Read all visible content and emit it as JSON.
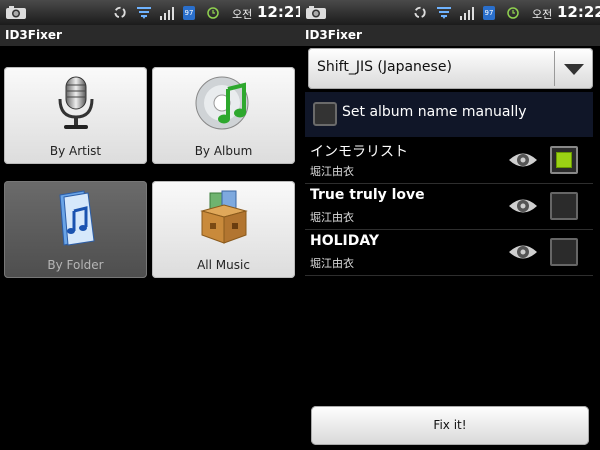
{
  "left_screen": {
    "status": {
      "ampm": "오전",
      "time": "12:21",
      "badge": "97"
    },
    "app_title": "ID3Fixer",
    "tiles": [
      {
        "label": "By Artist",
        "icon": "microphone-icon",
        "enabled": true
      },
      {
        "label": "By Album",
        "icon": "music-disc-icon",
        "enabled": true
      },
      {
        "label": "By Folder",
        "icon": "music-folder-icon",
        "enabled": false
      },
      {
        "label": "All Music",
        "icon": "music-box-icon",
        "enabled": true
      }
    ]
  },
  "right_screen": {
    "status": {
      "ampm": "오전",
      "time": "12:22",
      "badge": "97"
    },
    "app_title": "ID3Fixer",
    "encoding": {
      "selected": "Shift_JIS (Japanese)"
    },
    "album_option": {
      "label": "Set album name manually",
      "checked": false
    },
    "songs": [
      {
        "title": "インモラリスト",
        "artist": "堀江由衣",
        "checked": true
      },
      {
        "title": "True truly love",
        "artist": "堀江由衣",
        "checked": false
      },
      {
        "title": "HOLIDAY",
        "artist": "堀江由衣",
        "checked": false
      }
    ],
    "fix_button": {
      "label": "Fix it!"
    }
  },
  "colors": {
    "check_green": "#9bd214",
    "album_row_bg": "#101628",
    "status_bg": "#2a2a2a"
  }
}
